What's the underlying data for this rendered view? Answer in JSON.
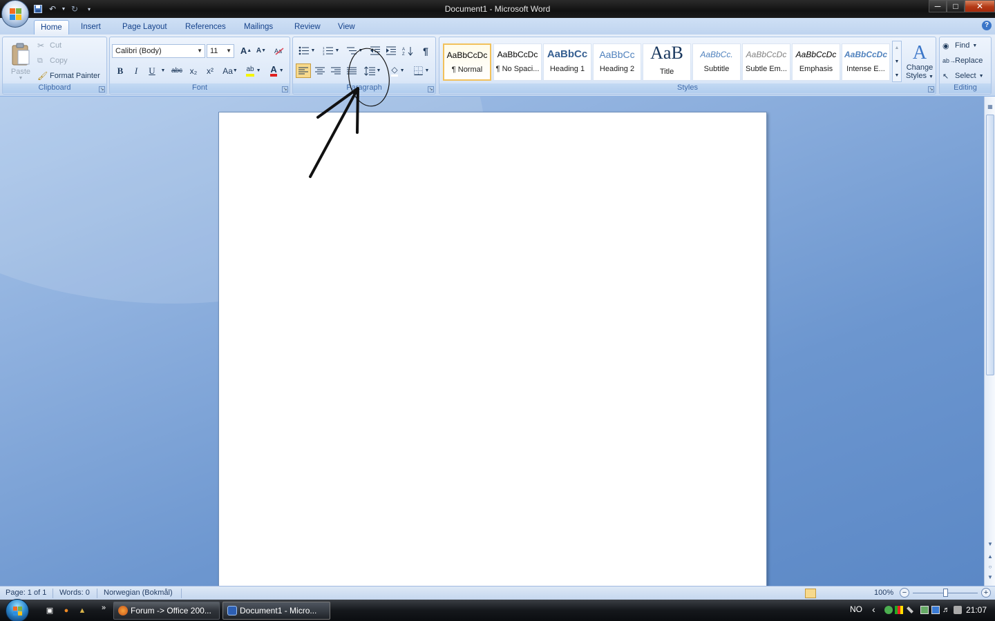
{
  "window": {
    "title": "Document1 - Microsoft Word",
    "minimize": "─",
    "maximize": "□",
    "close": "✕"
  },
  "qat": {
    "save_icon": "save-icon",
    "undo_icon": "undo-icon",
    "redo_icon": "redo-icon",
    "customize_icon": "customize-qat-icon"
  },
  "tabs": [
    "Home",
    "Insert",
    "Page Layout",
    "References",
    "Mailings",
    "Review",
    "View"
  ],
  "ribbon": {
    "clipboard": {
      "label": "Clipboard",
      "paste": "Paste",
      "cut": "Cut",
      "copy": "Copy",
      "format_painter": "Format Painter"
    },
    "font": {
      "label": "Font",
      "font_name": "Calibri (Body)",
      "font_size": "11",
      "bold": "B",
      "italic": "I",
      "underline": "U",
      "strikethrough": "abc",
      "subscript": "x₂",
      "superscript": "x²",
      "change_case": "Aa",
      "grow": "A",
      "shrink": "A",
      "font_color_letter": "A",
      "highlight_letter": "ab"
    },
    "paragraph": {
      "label": "Paragraph"
    },
    "styles": {
      "label": "Styles",
      "items": [
        {
          "sample": "AaBbCcDc",
          "name": "¶ Normal"
        },
        {
          "sample": "AaBbCcDc",
          "name": "¶ No Spaci..."
        },
        {
          "sample": "AaBbCc",
          "name": "Heading 1"
        },
        {
          "sample": "AaBbCc",
          "name": "Heading 2"
        },
        {
          "sample": "AaB",
          "name": "Title"
        },
        {
          "sample": "AaBbCc.",
          "name": "Subtitle"
        },
        {
          "sample": "AaBbCcDc",
          "name": "Subtle Em..."
        },
        {
          "sample": "AaBbCcDc",
          "name": "Emphasis"
        },
        {
          "sample": "AaBbCcDc",
          "name": "Intense E..."
        }
      ],
      "change_styles_line1": "Change",
      "change_styles_line2": "Styles"
    },
    "editing": {
      "label": "Editing",
      "find": "Find",
      "replace": "Replace",
      "select": "Select"
    }
  },
  "status": {
    "page": "Page: 1 of 1",
    "words": "Words: 0",
    "language": "Norwegian (Bokmål)",
    "zoom": "100%",
    "zoom_fraction": 0.5
  },
  "taskbar": {
    "items": [
      {
        "label": "Forum -> Office 200..."
      },
      {
        "label": "Document1 - Micro..."
      }
    ],
    "quick_more": "»",
    "lang": "NO",
    "tray_arrow": "‹",
    "clock": "21:07"
  }
}
